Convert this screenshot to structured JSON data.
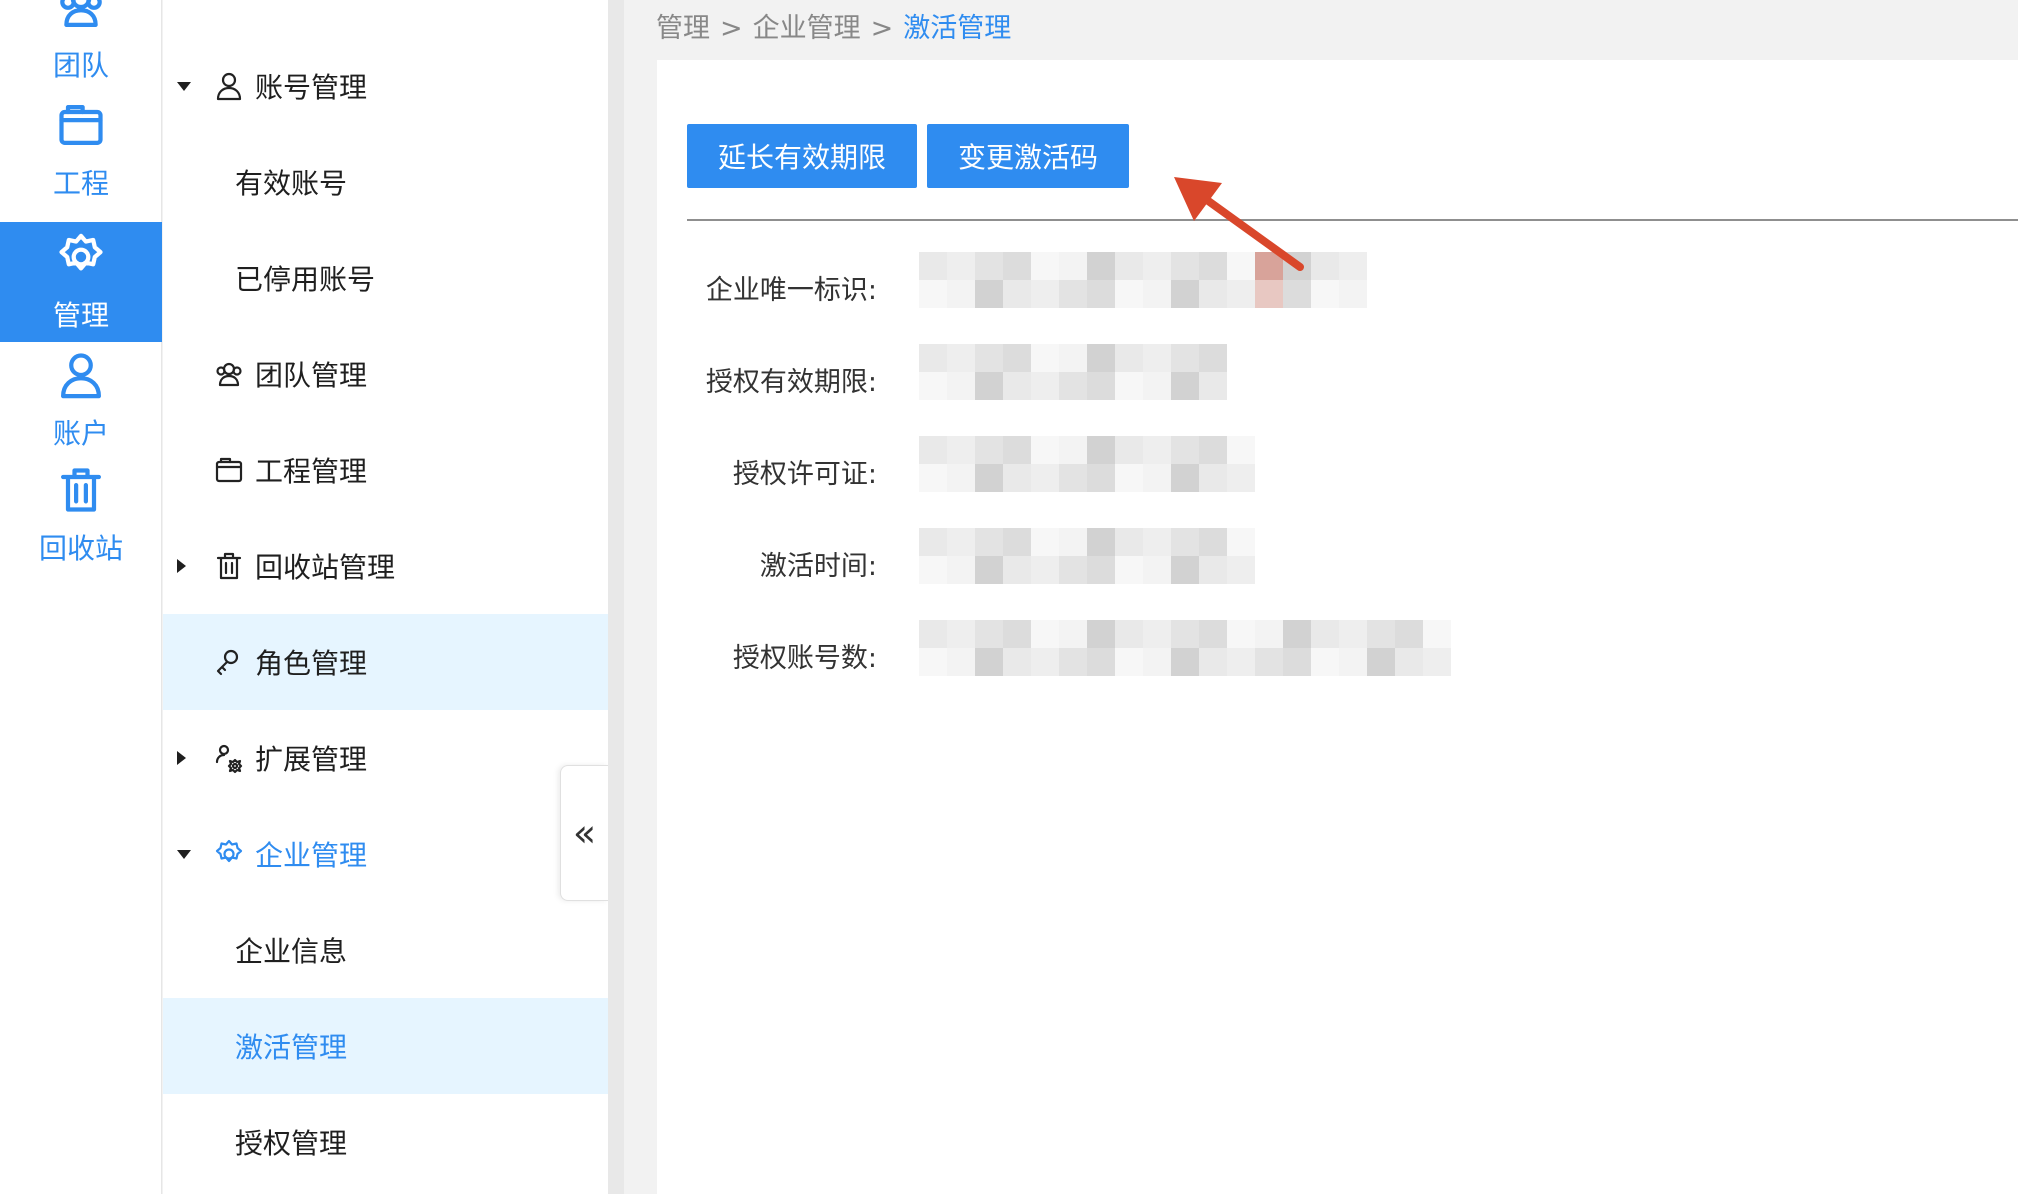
{
  "rail": [
    {
      "label": "团队",
      "icon": "team-icon",
      "active": false
    },
    {
      "label": "工程",
      "icon": "folder-icon",
      "active": false
    },
    {
      "label": "管理",
      "icon": "gear-icon",
      "active": true
    },
    {
      "label": "账户",
      "icon": "user-icon",
      "active": false
    },
    {
      "label": "回收站",
      "icon": "trash-icon",
      "active": false
    }
  ],
  "menu": [
    {
      "label": "账号管理",
      "icon": "user-icon",
      "expander": "down"
    },
    {
      "label": "有效账号",
      "sub": true
    },
    {
      "label": "已停用账号",
      "sub": true
    },
    {
      "label": "团队管理",
      "icon": "team-icon"
    },
    {
      "label": "工程管理",
      "icon": "folder-icon"
    },
    {
      "label": "回收站管理",
      "icon": "trash-icon",
      "expander": "right"
    },
    {
      "label": "角色管理",
      "icon": "key-user-icon",
      "highlight": true
    },
    {
      "label": "扩展管理",
      "icon": "puzzle-icon",
      "expander": "right"
    },
    {
      "label": "企业管理",
      "icon": "gear-icon",
      "expander": "down",
      "selected_parent": true
    },
    {
      "label": "企业信息",
      "sub": true
    },
    {
      "label": "激活管理",
      "sub": true,
      "highlight": true,
      "selected": true
    },
    {
      "label": "授权管理",
      "sub": true
    }
  ],
  "collapse_glyph": "«",
  "breadcrumb": {
    "items": [
      "管理",
      "企业管理"
    ],
    "current": "激活管理",
    "separator": ">"
  },
  "buttons": {
    "extend": "延长有效期限",
    "change_code": "变更激活码"
  },
  "fields": [
    {
      "label": "企业唯一标识:"
    },
    {
      "label": "授权有效期限:"
    },
    {
      "label": "授权许可证:"
    },
    {
      "label": "激活时间:"
    },
    {
      "label": "授权账号数:"
    }
  ],
  "colors": {
    "accent": "#2f8cf0",
    "highlight_bg": "#e6f5ff",
    "arrow": "#d9472b"
  }
}
